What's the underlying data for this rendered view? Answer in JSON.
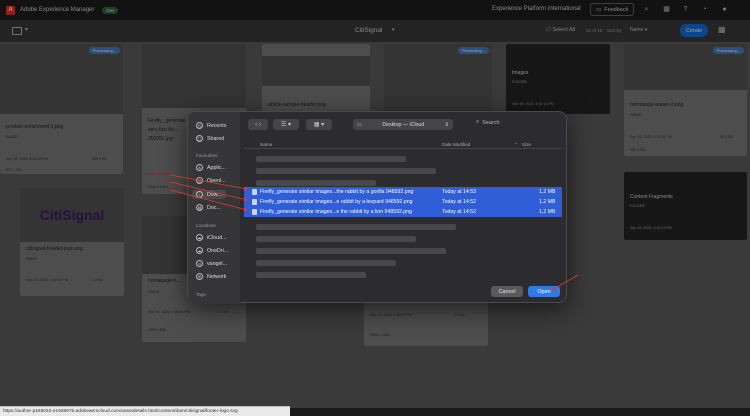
{
  "header": {
    "app_title": "Adobe Experience Manager",
    "env_badge": "Dev",
    "org": "Experience Platform International",
    "feedback": "Feedback"
  },
  "toolbar": {
    "breadcrumb": "CitiSignal",
    "select_all": "Select All",
    "count": "12 of 12",
    "sort_by": "Sort by",
    "sort_value": "Name",
    "create": "Create"
  },
  "assets": [
    {
      "title": "product-enrichment-1.png",
      "type": "IMAGE",
      "date": "Sep 19, 2025, 4:10:13 PM",
      "size": "365.9 KB",
      "dims": "837 x 505",
      "badge": "Processing..."
    },
    {
      "title": "Firefly_ generate similar images...",
      "title2": "very fast thr...",
      "title3": "250051.jpg",
      "date": "Sep 19, 2025",
      "dims": "2048 x 1dee"
    },
    {
      "title": "article-sample-header.png"
    },
    {
      "title": "",
      "badge": "Processing..."
    },
    {
      "title": "Images",
      "type": "FOLDER",
      "date": "Sep 19, 2025, 4:10:13 PM"
    },
    {
      "title": "homepage-teaser-2.png",
      "type": "IMAGE",
      "date": "Sep 19, 2025, 4:10:05 PM",
      "size": "20.3 KB",
      "dims": "962 x 532",
      "badge": "Processing..."
    },
    {
      "title": "citisignal-header-logo.svg",
      "type": "IMAGE",
      "date": "Sep 19, 2025, 4:10:00 PM",
      "size": "1.3 KB",
      "logo": "CitiSignal"
    },
    {
      "title": "homepage-h...",
      "type": "IMAGE",
      "date": "Sep 19, 2025, 4:10:00 PM",
      "size": "27.3 KB",
      "dims": "1600 x 846"
    },
    {
      "title": "",
      "date": "Sep 19, 2025, 4:10:00 PM",
      "size": "2.3 KB",
      "dims": "2002 x 1643"
    },
    {
      "title": "Content Fragments",
      "type": "FOLDER",
      "date": "Sep 19, 2025, 4:10:13 PM"
    }
  ],
  "dialog": {
    "sidebar": {
      "recents": "Recents",
      "shared": "Shared",
      "favourites": "Favourites",
      "fav_items": [
        "Applic...",
        "OpenI...",
        "Dow...",
        "Doc..."
      ],
      "locations": "Locations",
      "loc_items": [
        "iCloud...",
        "OneDri...",
        "vangel...",
        "Network"
      ],
      "tags": "Tags"
    },
    "location": "Desktop — iCloud",
    "search": "Search",
    "columns": {
      "name": "Name",
      "date": "Date Modified",
      "size": "Size"
    },
    "files": [
      {
        "name": "Firefly_generate similar images...the rabbit by a gorilla 948592.png",
        "date": "Today at 14:53",
        "size": "1,2 MB"
      },
      {
        "name": "Firefly_generate similar images...e rabbit by a leopard 948592.png",
        "date": "Today at 14:52",
        "size": "1,2 MB"
      },
      {
        "name": "Firefly_generate similar images...e the rabbit by a lion 948592.png",
        "date": "Today at 14:52",
        "size": "1,2 MB"
      }
    ],
    "cancel": "Cancel",
    "open": "Open"
  },
  "status_url": "https://author-p165022-e1936676.adobeaemcloud.com/assetdetails.html/content/dam/citisignal/footer-logo.svg",
  "colors": {
    "accent": "#1473e6",
    "selection": "#2f5ed8",
    "annotation": "#e8362a"
  }
}
